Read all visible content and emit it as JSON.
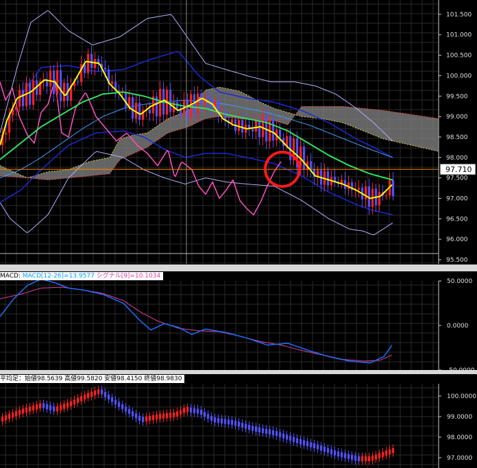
{
  "chart_data": [
    {
      "type": "candlestick",
      "title": "",
      "ylim": [
        95.4,
        101.85
      ],
      "y_ticks": [
        "101.500",
        "101.000",
        "100.500",
        "100.000",
        "99.500",
        "99.000",
        "98.500",
        "98.000",
        "97.500",
        "97.000",
        "96.500",
        "96.000",
        "95.500"
      ],
      "current_price": "97.710",
      "overlays": [
        "Bollinger Bands",
        "Moving Averages",
        "Ichimoku Cloud"
      ],
      "annotation": "red-circle",
      "colors": {
        "up": "#ff2020",
        "down": "#5050ff",
        "ma_short": "#ffff00",
        "ma_mid": "#30e060",
        "ma_long": "#3aa0ff",
        "boll": "#b0b0ff",
        "lagging": "#ff50c0",
        "cloud": "#808080",
        "price_line": "#ff8c00"
      }
    },
    {
      "type": "line",
      "label_text": "MACD: ",
      "series_labels": [
        {
          "text": "MACD[12-26]=13.9577",
          "color": "#00a0ff"
        },
        {
          "text": "シグナル[9]=10.1034",
          "color": "#e040a0"
        }
      ],
      "ylim": [
        -50,
        50
      ],
      "y_ticks": [
        "50.0000",
        "0.0000",
        "-50.0000"
      ]
    },
    {
      "type": "candlestick",
      "label_text": "平均足：始値98.5639  高値99.5820  安値98.4150  終値98.9830",
      "ylim": [
        96.5,
        100.6
      ],
      "y_ticks": [
        "100.0000",
        "99.0000",
        "98.0000",
        "97.0000"
      ]
    }
  ]
}
